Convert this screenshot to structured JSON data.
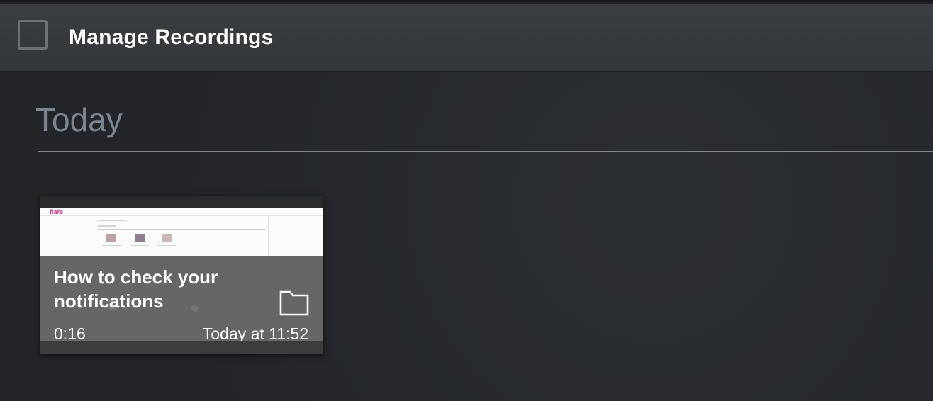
{
  "header": {
    "title": "Manage Recordings"
  },
  "section": {
    "title": "Today"
  },
  "recordings": [
    {
      "title": "How to check your notifications",
      "duration": "0:16",
      "date": "Today at 11:52",
      "thumbnail_logo": "flare"
    }
  ]
}
